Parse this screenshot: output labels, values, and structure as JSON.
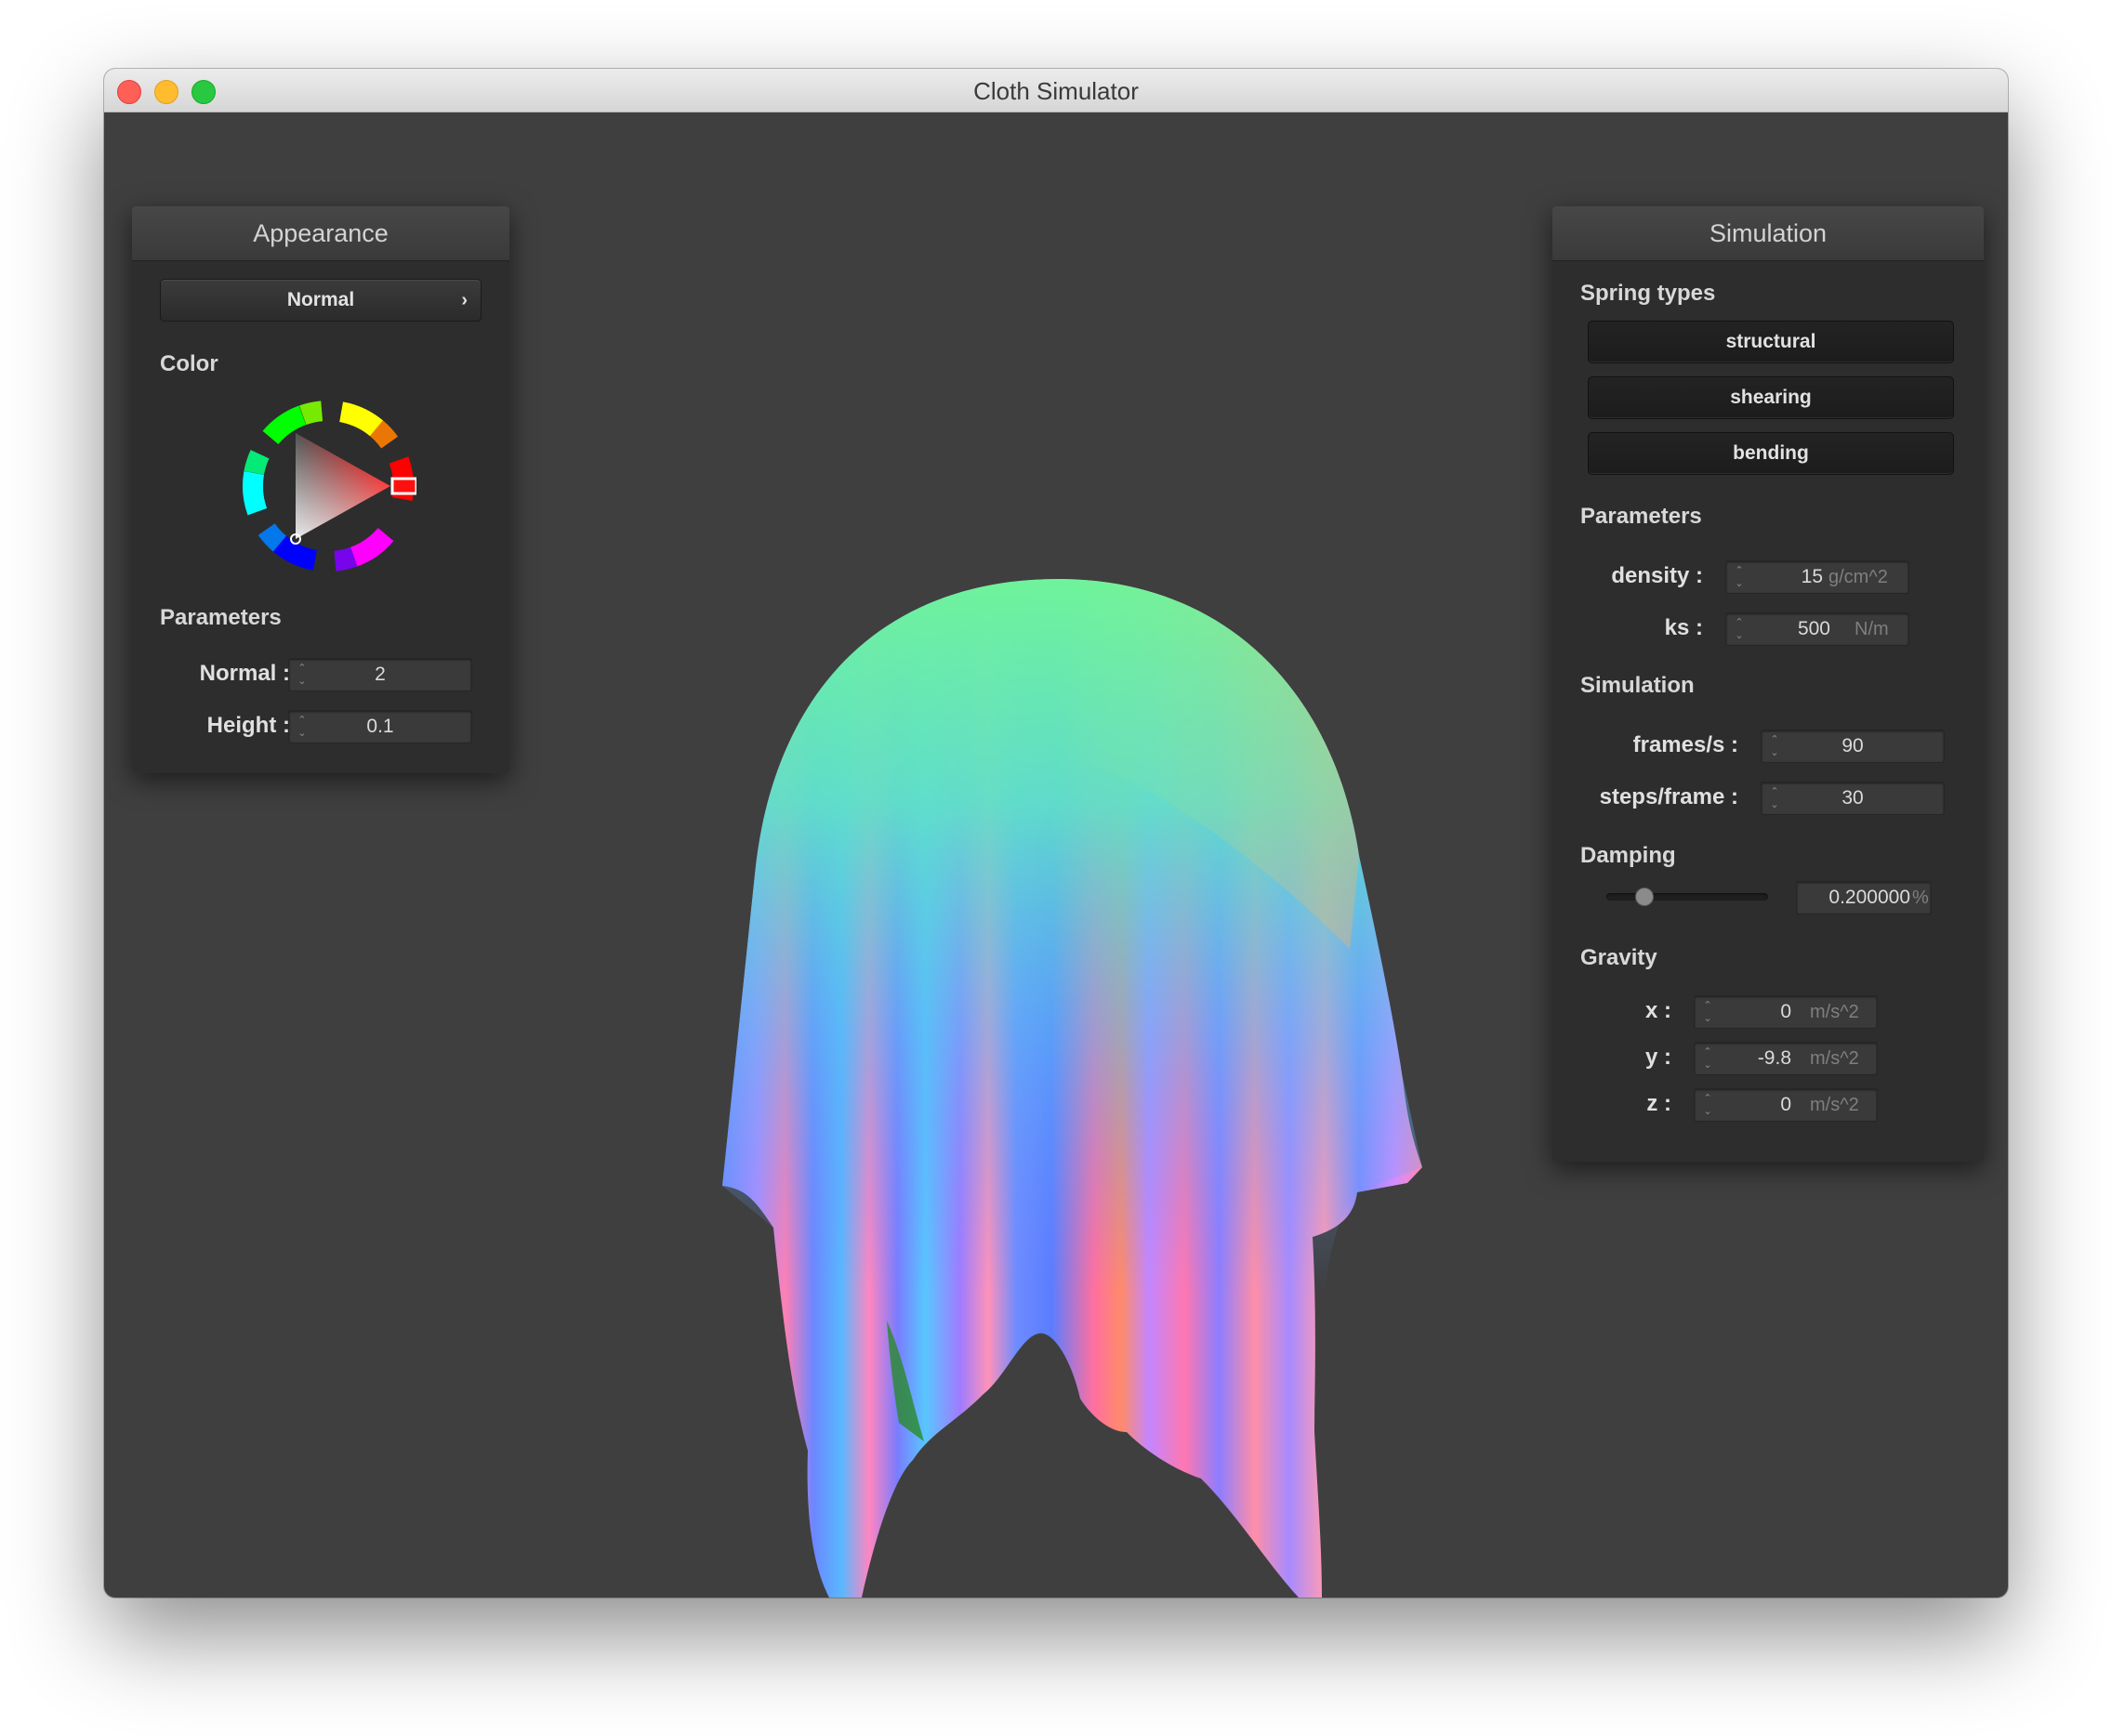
{
  "window": {
    "title": "Cloth Simulator"
  },
  "appearance": {
    "title": "Appearance",
    "shader": {
      "label": "Normal"
    },
    "color": {
      "heading": "Color",
      "hex": "#ff1010"
    },
    "params_heading": "Parameters",
    "params": [
      {
        "label": "Normal :",
        "value": "2"
      },
      {
        "label": "Height :",
        "value": "0.1"
      }
    ]
  },
  "simulation_panel": {
    "title": "Simulation",
    "spring_heading": "Spring types",
    "springs": [
      "structural",
      "shearing",
      "bending"
    ],
    "params_heading": "Parameters",
    "density": {
      "label": "density :",
      "value": "15",
      "unit": "g/cm^2"
    },
    "ks": {
      "label": "ks :",
      "value": "500",
      "unit": "N/m"
    },
    "sim_heading": "Simulation",
    "fps": {
      "label": "frames/s :",
      "value": "90"
    },
    "steps": {
      "label": "steps/frame :",
      "value": "30"
    },
    "damping_heading": "Damping",
    "damping": {
      "value": "0.200000",
      "unit": "%",
      "level": 0.2
    },
    "gravity_heading": "Gravity",
    "gravity": [
      {
        "label": "x :",
        "value": "0",
        "unit": "m/s^2"
      },
      {
        "label": "y :",
        "value": "-9.8",
        "unit": "m/s^2"
      },
      {
        "label": "z :",
        "value": "0",
        "unit": "m/s^2"
      }
    ]
  }
}
